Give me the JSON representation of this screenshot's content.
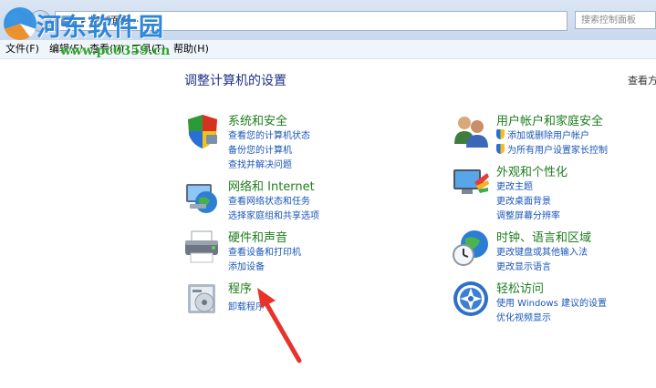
{
  "window": {
    "address_bar": {
      "crumb": "控制面板",
      "arrow": "▸"
    },
    "search_placeholder": "搜索控制面板"
  },
  "menu": {
    "file": "文件(F)",
    "edit": "编辑(E)",
    "view": "查看(V)",
    "tools": "工具(T)",
    "help": "帮助(H)"
  },
  "watermark": {
    "title": "河东软件园",
    "url": "www.pc0359.cn"
  },
  "page": {
    "title": "调整计算机的设置",
    "view_by": "查看方式:"
  },
  "categories": [
    {
      "icon": "shield-icon",
      "title": "系统和安全",
      "links": [
        "查看您的计算机状态",
        "备份您的计算机",
        "查找并解决问题"
      ]
    },
    {
      "icon": "network-globe-icon",
      "title": "网络和 Internet",
      "links": [
        "查看网络状态和任务",
        "选择家庭组和共享选项"
      ]
    },
    {
      "icon": "printer-icon",
      "title": "硬件和声音",
      "links": [
        "查看设备和打印机",
        "添加设备"
      ]
    },
    {
      "icon": "programs-icon",
      "title": "程序",
      "links": [
        "卸载程序"
      ]
    },
    {
      "icon": "users-icon",
      "title": "用户帐户和家庭安全",
      "links": [
        "添加或删除用户帐户",
        "为所有用户设置家长控制"
      ]
    },
    {
      "icon": "appearance-icon",
      "title": "外观和个性化",
      "links": [
        "更改主题",
        "更改桌面背景",
        "调整屏幕分辨率"
      ]
    },
    {
      "icon": "clock-globe-icon",
      "title": "时钟、语言和区域",
      "links": [
        "更改键盘或其他输入法",
        "更改显示语言"
      ]
    },
    {
      "icon": "ease-of-access-icon",
      "title": "轻松访问",
      "links": [
        "使用 Windows 建议的设置",
        "优化视频显示"
      ]
    }
  ],
  "colors": {
    "title_green": "#1e7d1e",
    "link_blue": "#1a56b8",
    "arrow_red": "#e8332b"
  }
}
